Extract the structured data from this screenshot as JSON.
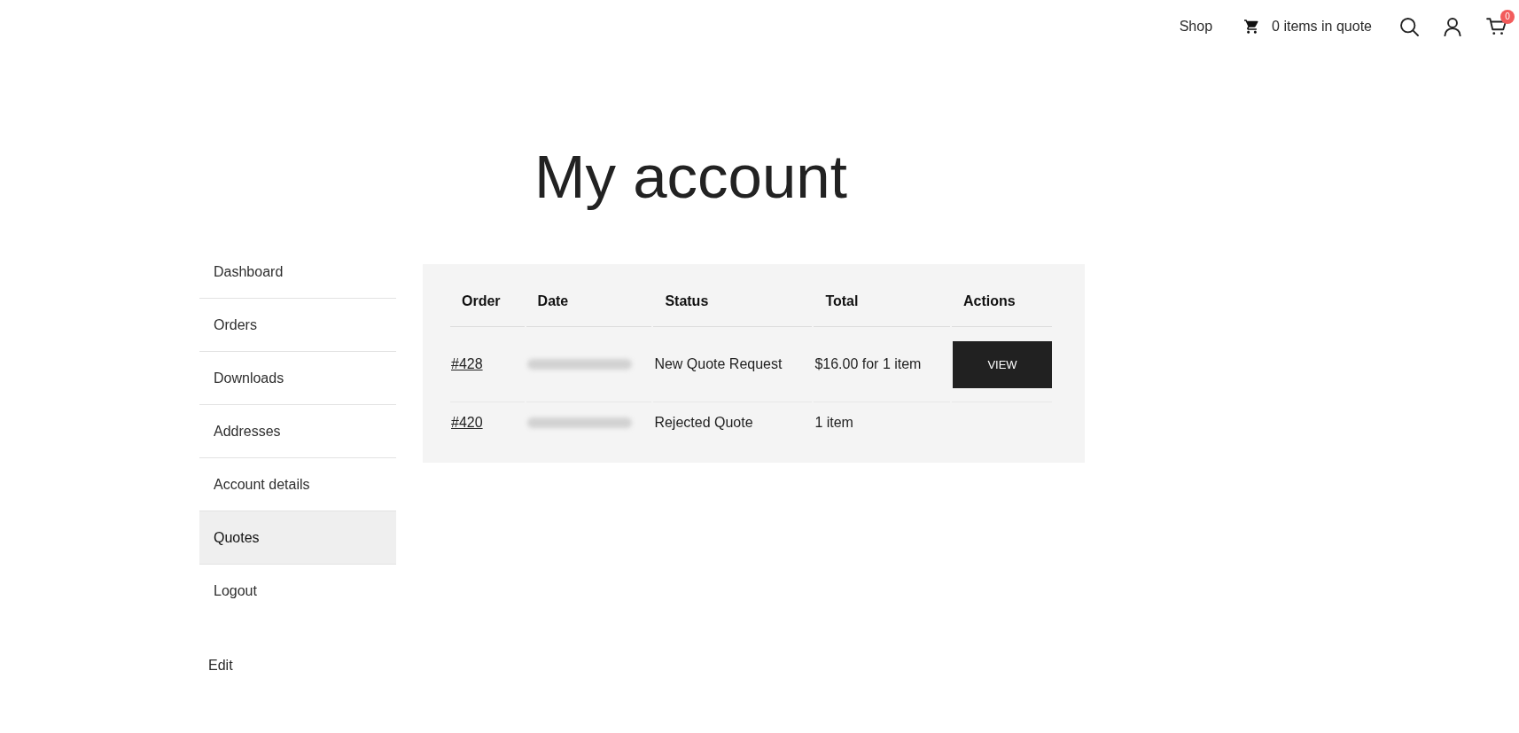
{
  "header": {
    "shop_link": "Shop",
    "quote_link": "0 items in quote",
    "cart_badge": "0"
  },
  "title": "My account",
  "sidebar": {
    "items": [
      {
        "label": "Dashboard",
        "selected": false
      },
      {
        "label": "Orders",
        "selected": false
      },
      {
        "label": "Downloads",
        "selected": false
      },
      {
        "label": "Addresses",
        "selected": false
      },
      {
        "label": "Account details",
        "selected": false
      },
      {
        "label": "Quotes",
        "selected": true
      },
      {
        "label": "Logout",
        "selected": false
      }
    ]
  },
  "table": {
    "columns": [
      "Order",
      "Date",
      "Status",
      "Total",
      "Actions"
    ],
    "rows": [
      {
        "order": "#428",
        "date_blurred": true,
        "status": "New Quote Request",
        "total": "$16.00 for 1 item",
        "actions": [
          "VIEW"
        ]
      },
      {
        "order": "#420",
        "date_blurred": true,
        "status": "Rejected Quote",
        "total": "1 item"
      }
    ]
  },
  "edit_link": "Edit"
}
